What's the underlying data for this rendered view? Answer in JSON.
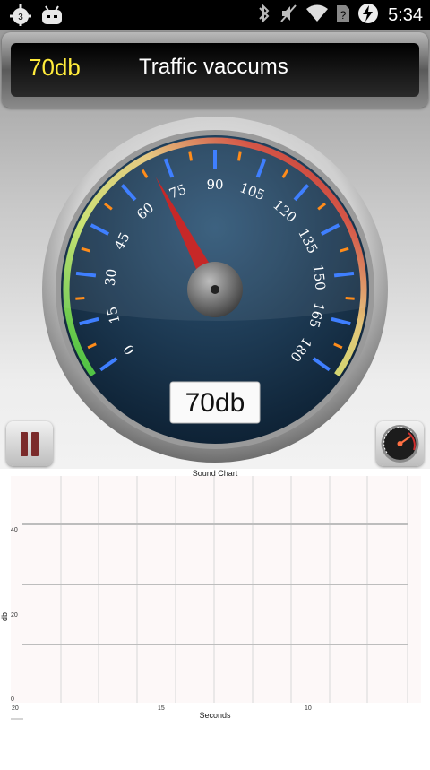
{
  "status_bar": {
    "time": "5:34",
    "icons": [
      "cyanogen-notification-icon",
      "android-robot-icon",
      "bluetooth-icon",
      "mute-icon",
      "wifi-icon",
      "no-sim-icon",
      "battery-charging-icon"
    ],
    "notification_count": "3"
  },
  "header": {
    "db_value": "70db",
    "title": "Traffic vaccums"
  },
  "gauge": {
    "readout": "70db",
    "value": 70,
    "min": 0,
    "max": 180,
    "tick_labels": [
      "0",
      "15",
      "30",
      "45",
      "60",
      "75",
      "90",
      "105",
      "120",
      "135",
      "150",
      "165",
      "180"
    ],
    "colors": {
      "face": "#1e3a57",
      "needle": "#d32f2f",
      "green": "#4caf50",
      "red": "#c62828",
      "blue_tick": "#3f7fff",
      "orange_tick": "#ff8c1a"
    }
  },
  "controls": {
    "pause_icon": "pause-icon",
    "gauge_icon": "mini-speedometer-icon"
  },
  "chart_data": {
    "type": "line",
    "title": "Sound Chart",
    "xlabel": "Seconds",
    "ylabel": "db",
    "x_ticks": [
      "20",
      "15",
      "10"
    ],
    "y_ticks": [
      "40",
      "20",
      "0"
    ],
    "grid": true,
    "series": []
  }
}
